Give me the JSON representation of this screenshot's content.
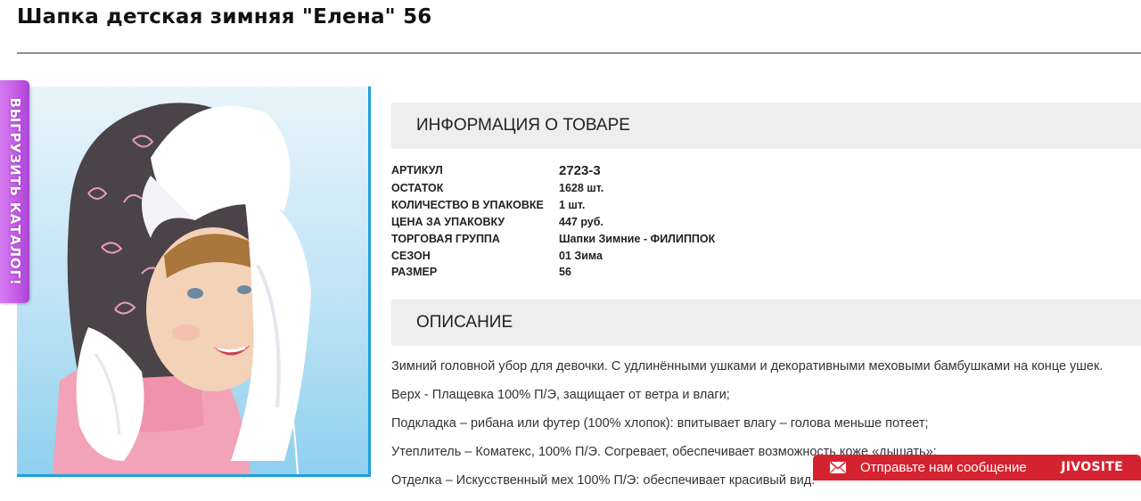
{
  "product": {
    "title": "Шапка детская зимняя \"Елена\" 56"
  },
  "catalog_tab": {
    "label": "ВЫГРУЗИТЬ КАТАЛОГ!"
  },
  "info_section": {
    "heading": "ИНФОРМАЦИЯ О ТОВАРЕ",
    "specs": [
      {
        "key": "АРТИКУЛ",
        "value": "2723-3"
      },
      {
        "key": "ОСТАТОК",
        "value": "1628 шт."
      },
      {
        "key": "КОЛИЧЕСТВО В УПАКОВКЕ",
        "value": "1 шт."
      },
      {
        "key": "ЦЕНА ЗА УПАКОВКУ",
        "value": "447 руб."
      },
      {
        "key": "ТОРГОВАЯ ГРУППА",
        "value": "Шапки Зимние - ФИЛИППОК"
      },
      {
        "key": "СЕЗОН",
        "value": "01 Зима"
      },
      {
        "key": "РАЗМЕР",
        "value": "56"
      }
    ]
  },
  "description_section": {
    "heading": "ОПИСАНИЕ",
    "paragraphs": [
      "Зимний головной убор для девочки. С удлинёнными ушками и декоративными меховыми бамбушками на конце ушек.",
      "Верх - Плащевка 100% П/Э, защищает от ветра и влаги;",
      "Подкладка – рибана или футер (100% хлопок): впитывает влагу – голова меньше потеет;",
      "Утеплитель – Коматекс, 100% П/Э. Согревает, обеспечивает возможность коже «дышать»;",
      "Отделка – Искусственный мех 100% П/Э: обеспечивает красивый вид."
    ]
  },
  "chat_widget": {
    "label": "Отправьте нам сообщение",
    "brand": "JIVOSITE",
    "icon": "mail-icon",
    "background_color": "#d4232f"
  },
  "colors": {
    "photo_border": "#1ea0d8",
    "catalog_tab": "#c25ae6",
    "section_header_bg": "#eeeeee"
  }
}
